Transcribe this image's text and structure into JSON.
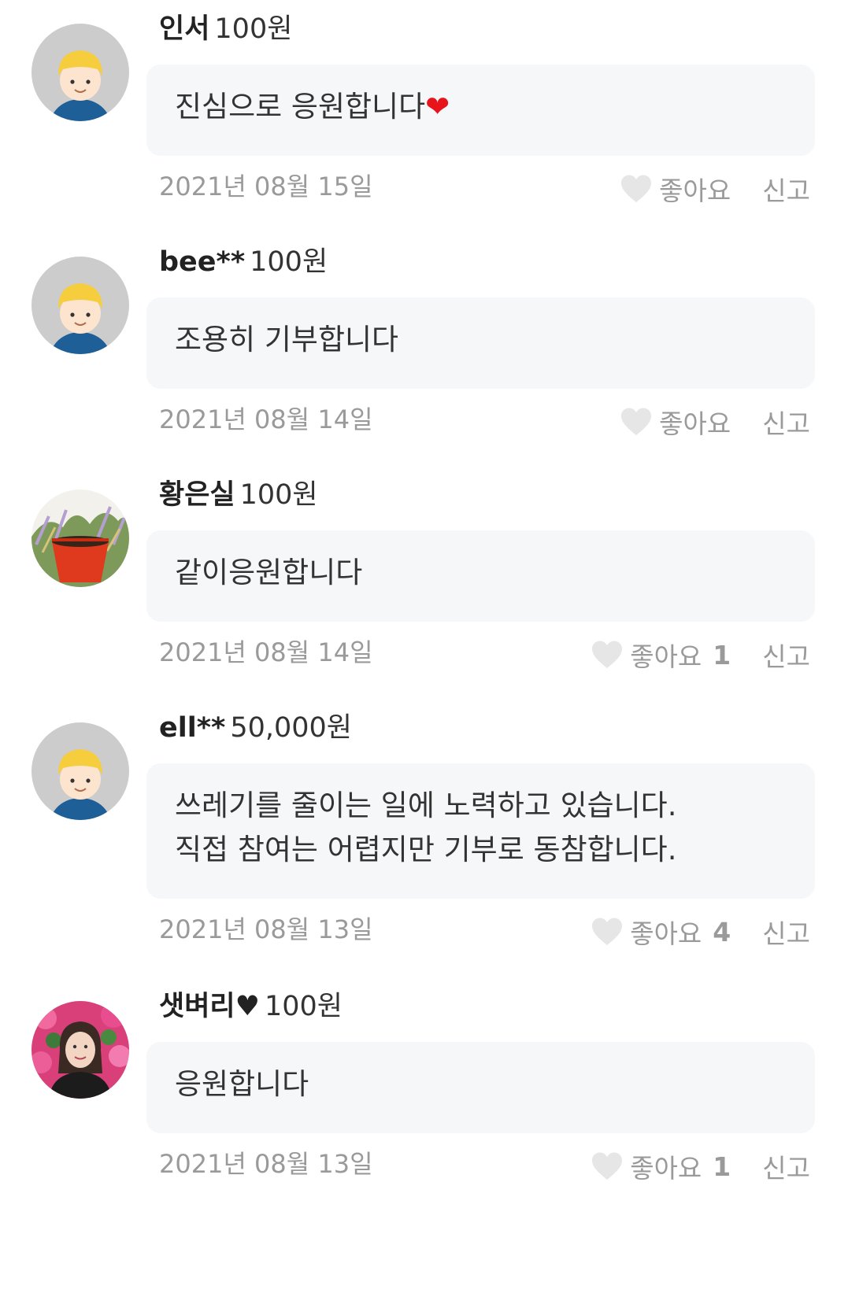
{
  "comments": [
    {
      "nickname": "인서",
      "amount": "100원",
      "message_lines": [
        "진심으로 응원합니다"
      ],
      "emoji": "❤",
      "date": "2021년 08월 15일",
      "like_label": "좋아요",
      "like_count": "",
      "report_label": "신고",
      "avatar": "default-avatar"
    },
    {
      "nickname": "bee**",
      "amount": "100원",
      "message_lines": [
        "조용히 기부합니다"
      ],
      "emoji": "",
      "date": "2021년 08월 14일",
      "like_label": "좋아요",
      "like_count": "",
      "report_label": "신고",
      "avatar": "default-avatar"
    },
    {
      "nickname": "황은실",
      "amount": "100원",
      "message_lines": [
        "같이응원합니다"
      ],
      "emoji": "",
      "date": "2021년 08월 14일",
      "like_label": "좋아요",
      "like_count": "1",
      "report_label": "신고",
      "avatar": "flowerpot-photo-avatar"
    },
    {
      "nickname": "ell**",
      "amount": "50,000원",
      "message_lines": [
        "쓰레기를 줄이는 일에 노력하고 있습니다.",
        "직접 참여는 어렵지만 기부로 동참합니다."
      ],
      "emoji": "",
      "date": "2021년 08월 13일",
      "like_label": "좋아요",
      "like_count": "4",
      "report_label": "신고",
      "avatar": "default-avatar"
    },
    {
      "nickname": "샛벼리♥",
      "amount": "100원",
      "message_lines": [
        "응원합니다"
      ],
      "emoji": "",
      "date": "2021년 08월 13일",
      "like_label": "좋아요",
      "like_count": "1",
      "report_label": "신고",
      "avatar": "person-photo-avatar"
    }
  ],
  "colors": {
    "bubble_bg": "#f6f7f9",
    "meta_text": "#9a9a9a",
    "heart_outline": "#e6e6e6",
    "emoji_heart": "#e8141b"
  }
}
